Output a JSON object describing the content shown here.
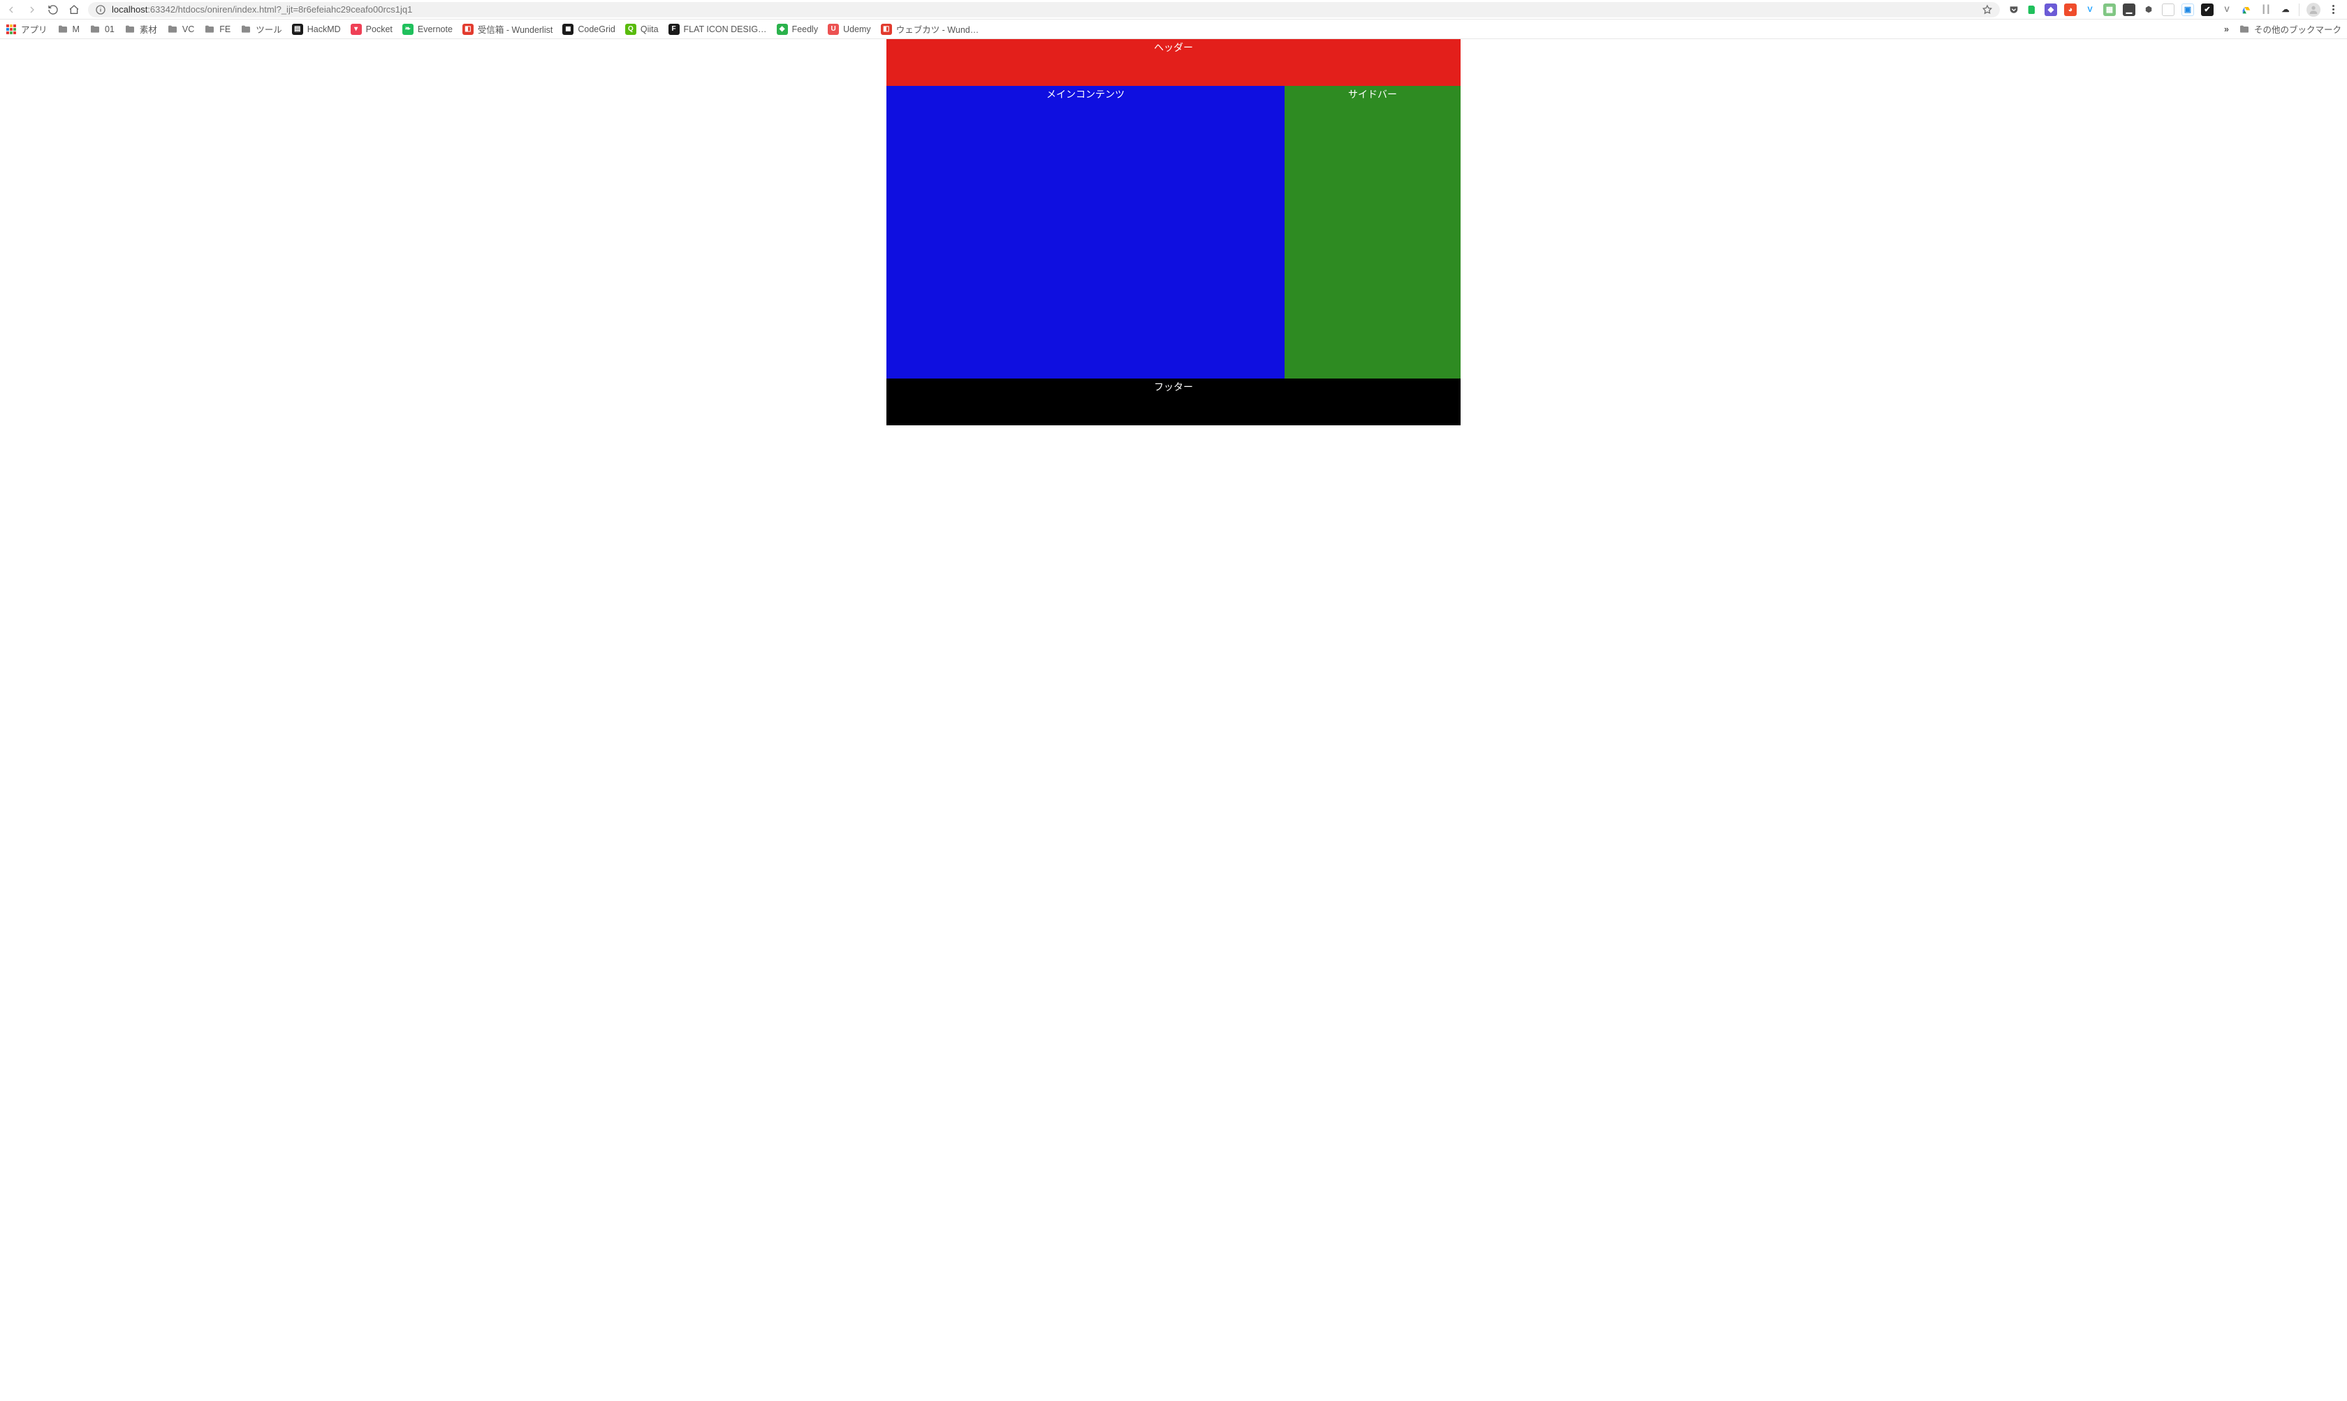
{
  "address": {
    "host": "localhost",
    "path": ":63342/htdocs/oniren/index.html?_ijt=8r6efeiahc29ceafo00rcs1jq1"
  },
  "bookmarks": {
    "apps": "アプリ",
    "items": [
      {
        "type": "folder",
        "label": "M"
      },
      {
        "type": "folder",
        "label": "01"
      },
      {
        "type": "folder",
        "label": "素材"
      },
      {
        "type": "folder",
        "label": "VC"
      },
      {
        "type": "folder",
        "label": "FE"
      },
      {
        "type": "folder",
        "label": "ツール"
      },
      {
        "type": "page",
        "label": "HackMD",
        "bg": "#1b1b1b",
        "glyph": "▤"
      },
      {
        "type": "page",
        "label": "Pocket",
        "bg": "#ef4056",
        "glyph": "▾"
      },
      {
        "type": "page",
        "label": "Evernote",
        "bg": "#20c05c",
        "glyph": "❧"
      },
      {
        "type": "page",
        "label": "受信箱 - Wunderlist",
        "bg": "#e23b2e",
        "glyph": "◧"
      },
      {
        "type": "page",
        "label": "CodeGrid",
        "bg": "#1b1b1b",
        "glyph": "◼"
      },
      {
        "type": "page",
        "label": "Qiita",
        "bg": "#59bb0c",
        "glyph": "Q"
      },
      {
        "type": "page",
        "label": "FLAT ICON DESIG…",
        "bg": "#1b1b1b",
        "glyph": "F"
      },
      {
        "type": "page",
        "label": "Feedly",
        "bg": "#2bb24c",
        "glyph": "◆"
      },
      {
        "type": "page",
        "label": "Udemy",
        "bg": "#ec5252",
        "glyph": "U"
      },
      {
        "type": "page",
        "label": "ウェブカツ - Wund…",
        "bg": "#e23b2e",
        "glyph": "◧"
      }
    ],
    "overflow": "»",
    "other": "その他のブックマーク"
  },
  "page": {
    "header": "ヘッダー",
    "main": "メインコンテンツ",
    "sidebar": "サイドバー",
    "footer": "フッター"
  },
  "colors": {
    "header": "#e31f1b",
    "main": "#0f0fe0",
    "sidebar": "#2e8b22",
    "footer": "#000000"
  }
}
